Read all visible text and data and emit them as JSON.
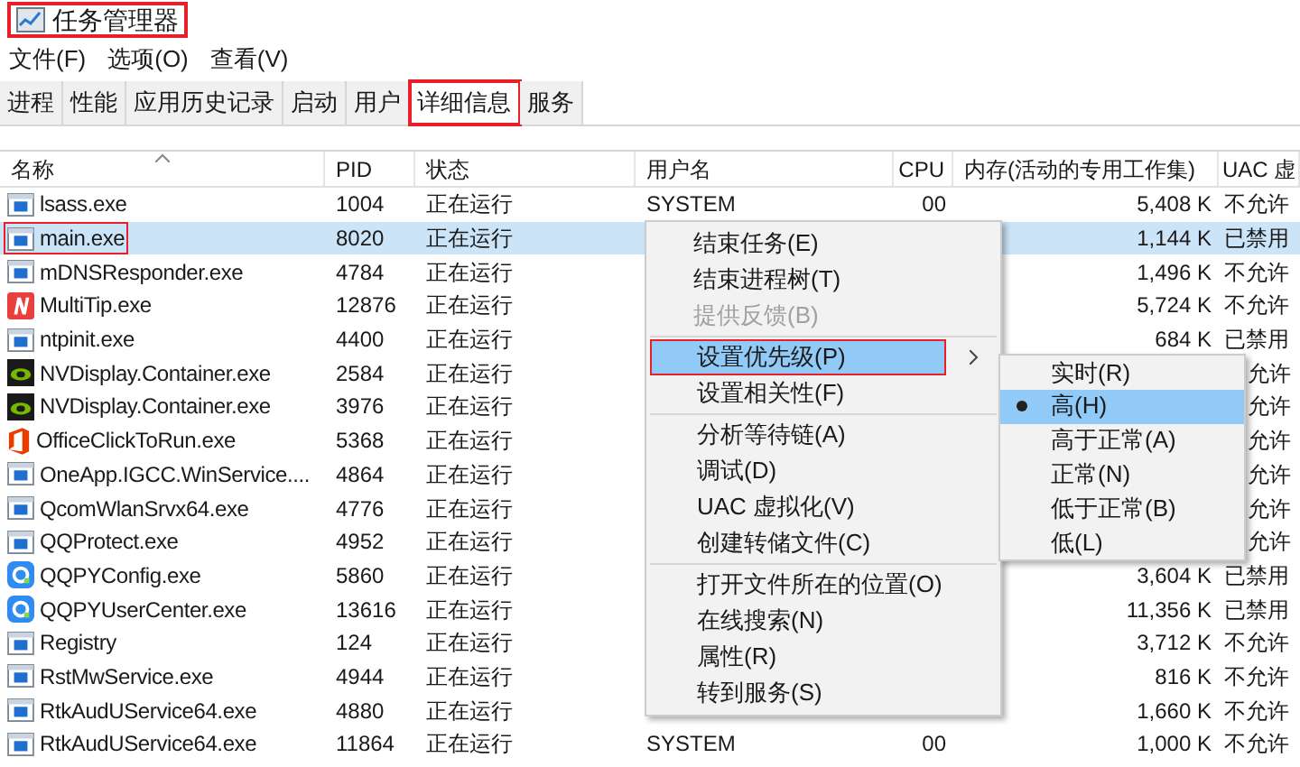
{
  "window": {
    "title": "任务管理器",
    "highlighted": true
  },
  "menu_bar": [
    "文件(F)",
    "选项(O)",
    "查看(V)"
  ],
  "tabs": [
    {
      "label": "进程",
      "selected": false,
      "highlighted": false
    },
    {
      "label": "性能",
      "selected": false,
      "highlighted": false
    },
    {
      "label": "应用历史记录",
      "selected": false,
      "highlighted": false
    },
    {
      "label": "启动",
      "selected": false,
      "highlighted": false
    },
    {
      "label": "用户",
      "selected": false,
      "highlighted": false
    },
    {
      "label": "详细信息",
      "selected": true,
      "highlighted": true
    },
    {
      "label": "服务",
      "selected": false,
      "highlighted": false
    }
  ],
  "table": {
    "columns": [
      "名称",
      "PID",
      "状态",
      "用户名",
      "CPU",
      "内存(活动的专用工作集)",
      "UAC 虚"
    ],
    "rows": [
      {
        "kind": "app",
        "name": "lsass.exe",
        "pid": "1004",
        "status": "正在运行",
        "user": "SYSTEM",
        "cpu": "00",
        "memory": "5,408 K",
        "uac": "不允许",
        "selected": false,
        "highlighted": false
      },
      {
        "kind": "app",
        "name": "main.exe",
        "pid": "8020",
        "status": "正在运行",
        "memory": "1,144 K",
        "uac": "已禁用",
        "selected": true,
        "highlighted": true
      },
      {
        "kind": "app",
        "name": "mDNSResponder.exe",
        "pid": "4784",
        "status": "正在运行",
        "memory": "1,496 K",
        "uac": "不允许",
        "selected": false,
        "highlighted": false
      },
      {
        "kind": "multitip",
        "name": "MultiTip.exe",
        "pid": "12876",
        "status": "正在运行",
        "memory": "5,724 K",
        "uac": "不允许",
        "selected": false,
        "highlighted": false
      },
      {
        "kind": "app",
        "name": "ntpinit.exe",
        "pid": "4400",
        "status": "正在运行",
        "memory": "684 K",
        "uac": "已禁用",
        "selected": false,
        "highlighted": false
      },
      {
        "kind": "nvidia",
        "name": "NVDisplay.Container.exe",
        "pid": "2584",
        "status": "正在运行",
        "uac": "允许",
        "selected": false,
        "highlighted": false
      },
      {
        "kind": "nvidia",
        "name": "NVDisplay.Container.exe",
        "pid": "3976",
        "status": "正在运行",
        "uac": "允许",
        "selected": false,
        "highlighted": false
      },
      {
        "kind": "office",
        "name": "OfficeClickToRun.exe",
        "pid": "5368",
        "status": "正在运行",
        "uac": "允许",
        "selected": false,
        "highlighted": false
      },
      {
        "kind": "app",
        "name": "OneApp.IGCC.WinService....",
        "pid": "4864",
        "status": "正在运行",
        "uac": "允许",
        "selected": false,
        "highlighted": false
      },
      {
        "kind": "app",
        "name": "QcomWlanSrvx64.exe",
        "pid": "4776",
        "status": "正在运行",
        "uac": "允许",
        "selected": false,
        "highlighted": false
      },
      {
        "kind": "app",
        "name": "QQProtect.exe",
        "pid": "4952",
        "status": "正在运行",
        "uac": "允许",
        "selected": false,
        "highlighted": false
      },
      {
        "kind": "qq",
        "name": "QQPYConfig.exe",
        "pid": "5860",
        "status": "正在运行",
        "memory": "3,604 K",
        "uac": "已禁用",
        "selected": false,
        "highlighted": false
      },
      {
        "kind": "qq",
        "name": "QQPYUserCenter.exe",
        "pid": "13616",
        "status": "正在运行",
        "memory": "11,356 K",
        "uac": "已禁用",
        "selected": false,
        "highlighted": false
      },
      {
        "kind": "app",
        "name": "Registry",
        "pid": "124",
        "status": "正在运行",
        "memory": "3,712 K",
        "uac": "不允许",
        "selected": false,
        "highlighted": false
      },
      {
        "kind": "app",
        "name": "RstMwService.exe",
        "pid": "4944",
        "status": "正在运行",
        "memory": "816 K",
        "uac": "不允许",
        "selected": false,
        "highlighted": false
      },
      {
        "kind": "app",
        "name": "RtkAudUService64.exe",
        "pid": "4880",
        "status": "正在运行",
        "memory": "1,660 K",
        "uac": "不允许",
        "selected": false,
        "highlighted": false
      },
      {
        "kind": "app",
        "name": "RtkAudUService64.exe",
        "pid": "11864",
        "status": "正在运行",
        "user": "SYSTEM",
        "cpu": "00",
        "memory": "1,000 K",
        "uac": "不允许",
        "selected": false,
        "highlighted": false
      }
    ]
  },
  "context_menu": {
    "groups": [
      [
        {
          "label": "结束任务(E)",
          "disabled": false,
          "selected": false,
          "submenu": false,
          "highlighted": false
        },
        {
          "label": "结束进程树(T)",
          "disabled": false,
          "selected": false,
          "submenu": false,
          "highlighted": false
        },
        {
          "label": "提供反馈(B)",
          "disabled": true,
          "selected": false,
          "submenu": false,
          "highlighted": false
        }
      ],
      [
        {
          "label": "设置优先级(P)",
          "disabled": false,
          "selected": true,
          "submenu": true,
          "highlighted": true
        },
        {
          "label": "设置相关性(F)",
          "disabled": false,
          "selected": false,
          "submenu": false,
          "highlighted": false
        }
      ],
      [
        {
          "label": "分析等待链(A)",
          "disabled": false,
          "selected": false,
          "submenu": false,
          "highlighted": false
        },
        {
          "label": "调试(D)",
          "disabled": false,
          "selected": false,
          "submenu": false,
          "highlighted": false
        },
        {
          "label": "UAC 虚拟化(V)",
          "disabled": false,
          "selected": false,
          "submenu": false,
          "highlighted": false
        },
        {
          "label": "创建转储文件(C)",
          "disabled": false,
          "selected": false,
          "submenu": false,
          "highlighted": false
        }
      ],
      [
        {
          "label": "打开文件所在的位置(O)",
          "disabled": false,
          "selected": false,
          "submenu": false,
          "highlighted": false
        },
        {
          "label": "在线搜索(N)",
          "disabled": false,
          "selected": false,
          "submenu": false,
          "highlighted": false
        },
        {
          "label": "属性(R)",
          "disabled": false,
          "selected": false,
          "submenu": false,
          "highlighted": false
        },
        {
          "label": "转到服务(S)",
          "disabled": false,
          "selected": false,
          "submenu": false,
          "highlighted": false
        }
      ]
    ]
  },
  "priority_submenu": [
    {
      "label": "实时(R)",
      "selected": false,
      "checked": false
    },
    {
      "label": "高(H)",
      "selected": true,
      "checked": true
    },
    {
      "label": "高于正常(A)",
      "selected": false,
      "checked": false
    },
    {
      "label": "正常(N)",
      "selected": false,
      "checked": false
    },
    {
      "label": "低于正常(B)",
      "selected": false,
      "checked": false
    },
    {
      "label": "低(L)",
      "selected": false,
      "checked": false
    }
  ]
}
